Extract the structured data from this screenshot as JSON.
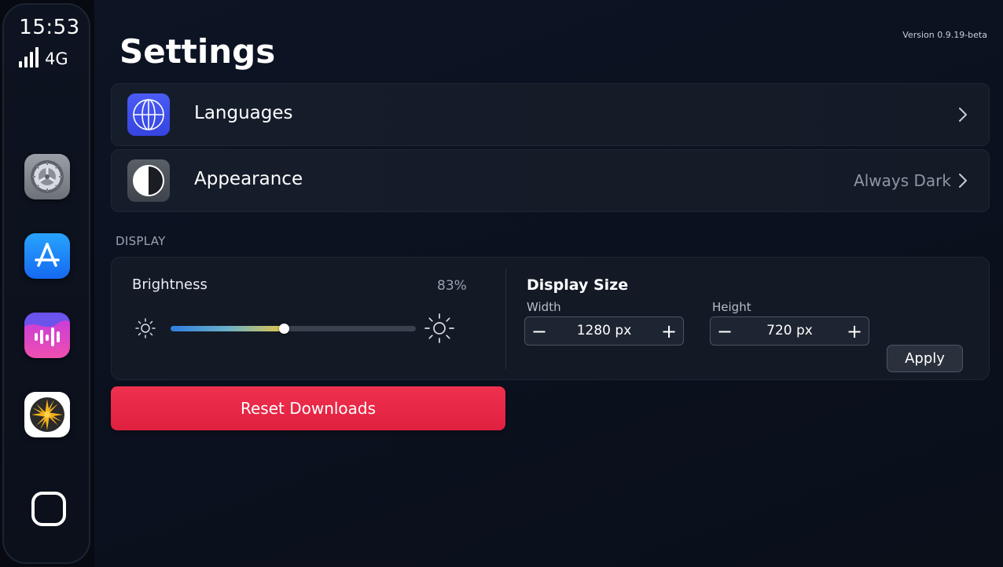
{
  "status_bar": {
    "time": "15:53",
    "network": "4G",
    "signal_bars": 4
  },
  "dock": {
    "apps": [
      {
        "name": "settings-app",
        "icon": "gear-icon",
        "color": "#8a8f98"
      },
      {
        "name": "app-store",
        "icon": "app-store-icon",
        "color": "#1a8cff"
      },
      {
        "name": "podcasts-app",
        "icon": "sound-wave-icon",
        "color": "#e040c8"
      },
      {
        "name": "starburst-app",
        "icon": "starburst-icon",
        "color": "#f5b21b"
      }
    ],
    "home_icon": "home-square-icon"
  },
  "header": {
    "title": "Settings",
    "version": "Version 0.9.19-beta"
  },
  "rows": {
    "languages": {
      "label": "Languages",
      "icon": "globe-icon",
      "icon_color": "#3a4ae8"
    },
    "appearance": {
      "label": "Appearance",
      "value": "Always Dark",
      "icon": "contrast-icon",
      "icon_color": "#4a4f58"
    }
  },
  "display": {
    "section_label": "DISPLAY",
    "brightness": {
      "label": "Brightness",
      "value_text": "83%",
      "slider_fraction": 0.46
    },
    "display_size": {
      "title": "Display Size",
      "width": {
        "label": "Width",
        "value": "1280 px",
        "minus": "−",
        "plus": "+"
      },
      "height": {
        "label": "Height",
        "value": "720 px",
        "minus": "−",
        "plus": "+"
      },
      "apply_label": "Apply"
    }
  },
  "reset_label": "Reset Downloads",
  "colors": {
    "accent_red": "#ec2a4a",
    "background": "#0b111e"
  }
}
